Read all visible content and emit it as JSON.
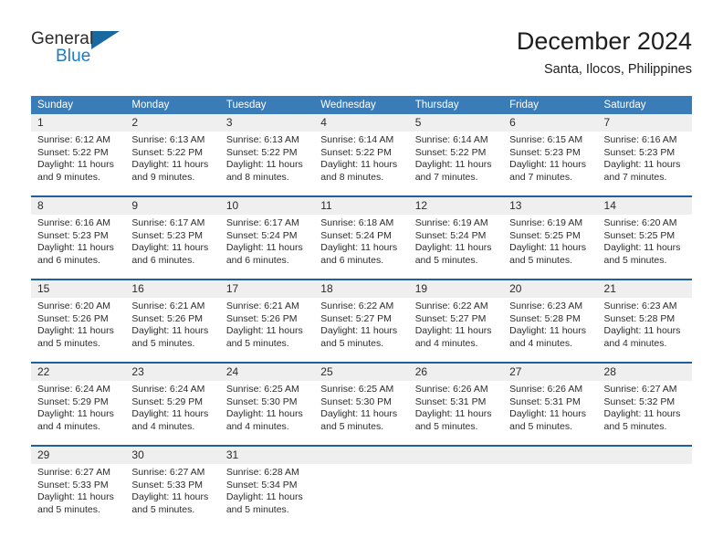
{
  "brand": {
    "line1": "General",
    "line2": "Blue",
    "triangle_color": "#17699f",
    "blue_color": "#1f7ac4"
  },
  "header": {
    "title": "December 2024",
    "subtitle": "Santa, Ilocos, Philippines"
  },
  "theme": {
    "header_bar": "#3a7cb8",
    "week_separator": "#1f5f9e",
    "daynum_band": "#efefef",
    "text": "#2b2b2b"
  },
  "weekdays": [
    "Sunday",
    "Monday",
    "Tuesday",
    "Wednesday",
    "Thursday",
    "Friday",
    "Saturday"
  ],
  "weeks": [
    [
      {
        "day": "1",
        "sunrise": "Sunrise: 6:12 AM",
        "sunset": "Sunset: 5:22 PM",
        "daylight1": "Daylight: 11 hours",
        "daylight2": "and 9 minutes."
      },
      {
        "day": "2",
        "sunrise": "Sunrise: 6:13 AM",
        "sunset": "Sunset: 5:22 PM",
        "daylight1": "Daylight: 11 hours",
        "daylight2": "and 9 minutes."
      },
      {
        "day": "3",
        "sunrise": "Sunrise: 6:13 AM",
        "sunset": "Sunset: 5:22 PM",
        "daylight1": "Daylight: 11 hours",
        "daylight2": "and 8 minutes."
      },
      {
        "day": "4",
        "sunrise": "Sunrise: 6:14 AM",
        "sunset": "Sunset: 5:22 PM",
        "daylight1": "Daylight: 11 hours",
        "daylight2": "and 8 minutes."
      },
      {
        "day": "5",
        "sunrise": "Sunrise: 6:14 AM",
        "sunset": "Sunset: 5:22 PM",
        "daylight1": "Daylight: 11 hours",
        "daylight2": "and 7 minutes."
      },
      {
        "day": "6",
        "sunrise": "Sunrise: 6:15 AM",
        "sunset": "Sunset: 5:23 PM",
        "daylight1": "Daylight: 11 hours",
        "daylight2": "and 7 minutes."
      },
      {
        "day": "7",
        "sunrise": "Sunrise: 6:16 AM",
        "sunset": "Sunset: 5:23 PM",
        "daylight1": "Daylight: 11 hours",
        "daylight2": "and 7 minutes."
      }
    ],
    [
      {
        "day": "8",
        "sunrise": "Sunrise: 6:16 AM",
        "sunset": "Sunset: 5:23 PM",
        "daylight1": "Daylight: 11 hours",
        "daylight2": "and 6 minutes."
      },
      {
        "day": "9",
        "sunrise": "Sunrise: 6:17 AM",
        "sunset": "Sunset: 5:23 PM",
        "daylight1": "Daylight: 11 hours",
        "daylight2": "and 6 minutes."
      },
      {
        "day": "10",
        "sunrise": "Sunrise: 6:17 AM",
        "sunset": "Sunset: 5:24 PM",
        "daylight1": "Daylight: 11 hours",
        "daylight2": "and 6 minutes."
      },
      {
        "day": "11",
        "sunrise": "Sunrise: 6:18 AM",
        "sunset": "Sunset: 5:24 PM",
        "daylight1": "Daylight: 11 hours",
        "daylight2": "and 6 minutes."
      },
      {
        "day": "12",
        "sunrise": "Sunrise: 6:19 AM",
        "sunset": "Sunset: 5:24 PM",
        "daylight1": "Daylight: 11 hours",
        "daylight2": "and 5 minutes."
      },
      {
        "day": "13",
        "sunrise": "Sunrise: 6:19 AM",
        "sunset": "Sunset: 5:25 PM",
        "daylight1": "Daylight: 11 hours",
        "daylight2": "and 5 minutes."
      },
      {
        "day": "14",
        "sunrise": "Sunrise: 6:20 AM",
        "sunset": "Sunset: 5:25 PM",
        "daylight1": "Daylight: 11 hours",
        "daylight2": "and 5 minutes."
      }
    ],
    [
      {
        "day": "15",
        "sunrise": "Sunrise: 6:20 AM",
        "sunset": "Sunset: 5:26 PM",
        "daylight1": "Daylight: 11 hours",
        "daylight2": "and 5 minutes."
      },
      {
        "day": "16",
        "sunrise": "Sunrise: 6:21 AM",
        "sunset": "Sunset: 5:26 PM",
        "daylight1": "Daylight: 11 hours",
        "daylight2": "and 5 minutes."
      },
      {
        "day": "17",
        "sunrise": "Sunrise: 6:21 AM",
        "sunset": "Sunset: 5:26 PM",
        "daylight1": "Daylight: 11 hours",
        "daylight2": "and 5 minutes."
      },
      {
        "day": "18",
        "sunrise": "Sunrise: 6:22 AM",
        "sunset": "Sunset: 5:27 PM",
        "daylight1": "Daylight: 11 hours",
        "daylight2": "and 5 minutes."
      },
      {
        "day": "19",
        "sunrise": "Sunrise: 6:22 AM",
        "sunset": "Sunset: 5:27 PM",
        "daylight1": "Daylight: 11 hours",
        "daylight2": "and 4 minutes."
      },
      {
        "day": "20",
        "sunrise": "Sunrise: 6:23 AM",
        "sunset": "Sunset: 5:28 PM",
        "daylight1": "Daylight: 11 hours",
        "daylight2": "and 4 minutes."
      },
      {
        "day": "21",
        "sunrise": "Sunrise: 6:23 AM",
        "sunset": "Sunset: 5:28 PM",
        "daylight1": "Daylight: 11 hours",
        "daylight2": "and 4 minutes."
      }
    ],
    [
      {
        "day": "22",
        "sunrise": "Sunrise: 6:24 AM",
        "sunset": "Sunset: 5:29 PM",
        "daylight1": "Daylight: 11 hours",
        "daylight2": "and 4 minutes."
      },
      {
        "day": "23",
        "sunrise": "Sunrise: 6:24 AM",
        "sunset": "Sunset: 5:29 PM",
        "daylight1": "Daylight: 11 hours",
        "daylight2": "and 4 minutes."
      },
      {
        "day": "24",
        "sunrise": "Sunrise: 6:25 AM",
        "sunset": "Sunset: 5:30 PM",
        "daylight1": "Daylight: 11 hours",
        "daylight2": "and 4 minutes."
      },
      {
        "day": "25",
        "sunrise": "Sunrise: 6:25 AM",
        "sunset": "Sunset: 5:30 PM",
        "daylight1": "Daylight: 11 hours",
        "daylight2": "and 5 minutes."
      },
      {
        "day": "26",
        "sunrise": "Sunrise: 6:26 AM",
        "sunset": "Sunset: 5:31 PM",
        "daylight1": "Daylight: 11 hours",
        "daylight2": "and 5 minutes."
      },
      {
        "day": "27",
        "sunrise": "Sunrise: 6:26 AM",
        "sunset": "Sunset: 5:31 PM",
        "daylight1": "Daylight: 11 hours",
        "daylight2": "and 5 minutes."
      },
      {
        "day": "28",
        "sunrise": "Sunrise: 6:27 AM",
        "sunset": "Sunset: 5:32 PM",
        "daylight1": "Daylight: 11 hours",
        "daylight2": "and 5 minutes."
      }
    ],
    [
      {
        "day": "29",
        "sunrise": "Sunrise: 6:27 AM",
        "sunset": "Sunset: 5:33 PM",
        "daylight1": "Daylight: 11 hours",
        "daylight2": "and 5 minutes."
      },
      {
        "day": "30",
        "sunrise": "Sunrise: 6:27 AM",
        "sunset": "Sunset: 5:33 PM",
        "daylight1": "Daylight: 11 hours",
        "daylight2": "and 5 minutes."
      },
      {
        "day": "31",
        "sunrise": "Sunrise: 6:28 AM",
        "sunset": "Sunset: 5:34 PM",
        "daylight1": "Daylight: 11 hours",
        "daylight2": "and 5 minutes."
      },
      {
        "day": "",
        "sunrise": "",
        "sunset": "",
        "daylight1": "",
        "daylight2": ""
      },
      {
        "day": "",
        "sunrise": "",
        "sunset": "",
        "daylight1": "",
        "daylight2": ""
      },
      {
        "day": "",
        "sunrise": "",
        "sunset": "",
        "daylight1": "",
        "daylight2": ""
      },
      {
        "day": "",
        "sunrise": "",
        "sunset": "",
        "daylight1": "",
        "daylight2": ""
      }
    ]
  ]
}
